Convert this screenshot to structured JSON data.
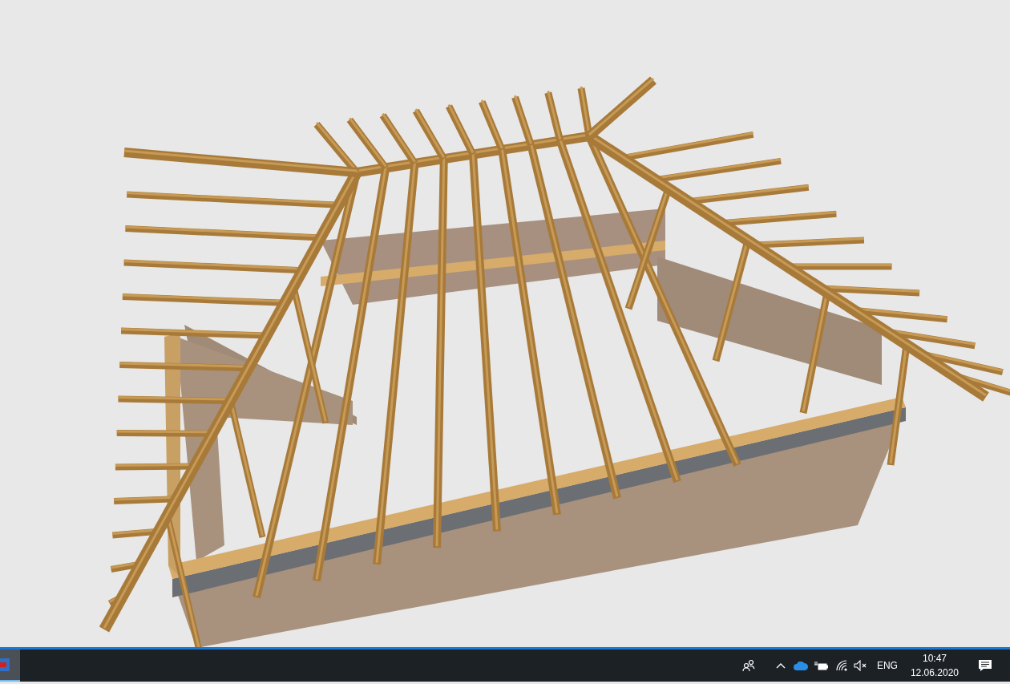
{
  "taskbar": {
    "pinned_app": {
      "active": true
    },
    "tray": {
      "language": "ENG",
      "time": "10:47",
      "date": "12.06.2020"
    }
  }
}
